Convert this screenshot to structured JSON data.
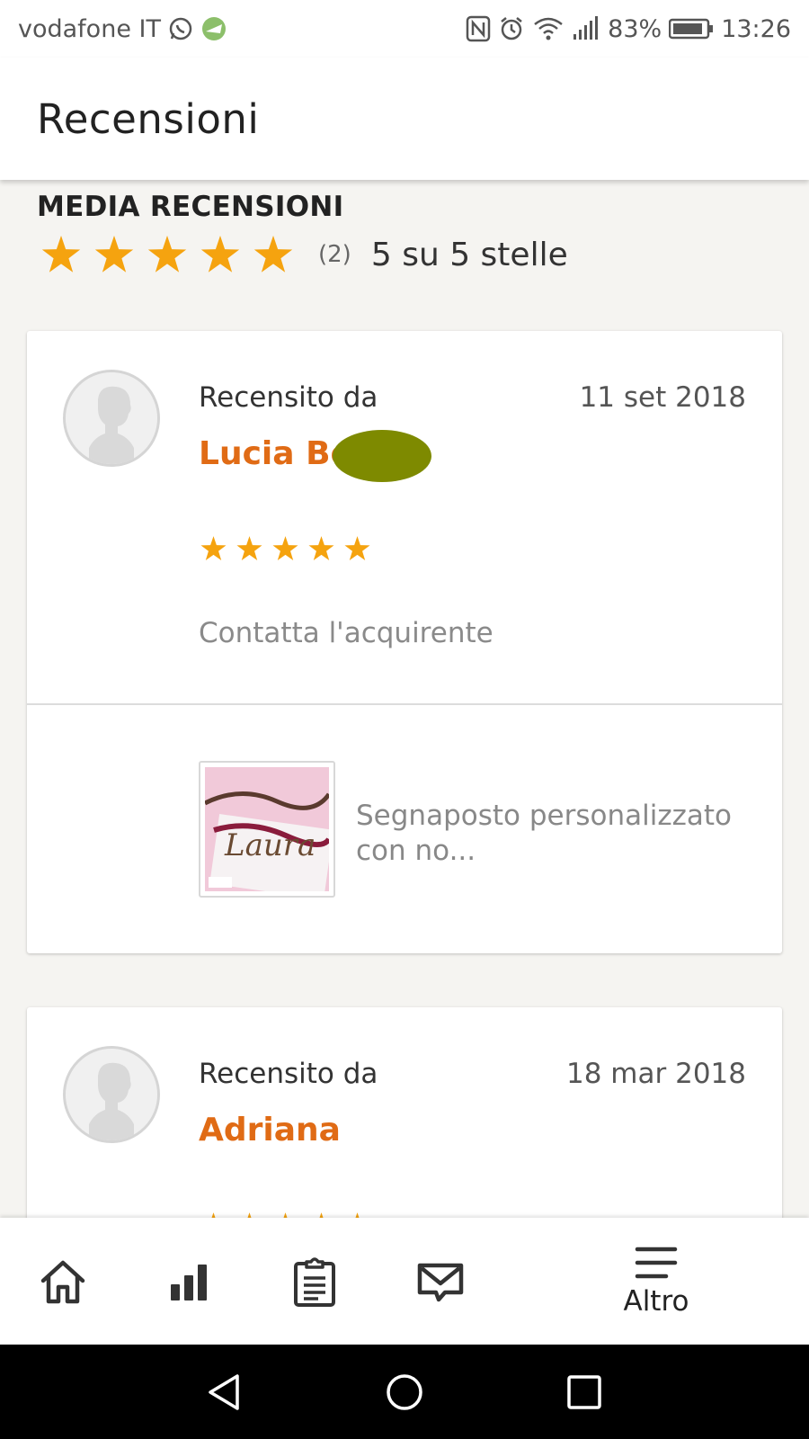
{
  "status_bar": {
    "carrier": "vodafone IT",
    "battery_percent": "83%",
    "time": "13:26"
  },
  "app_bar": {
    "title": "Recensioni"
  },
  "average": {
    "heading": "MEDIA RECENSIONI",
    "rating": 5,
    "count": "(2)",
    "summary": "5 su 5 stelle"
  },
  "reviews": [
    {
      "reviewed_by_label": "Recensito da",
      "date": "11 set 2018",
      "reviewer": "Lucia Be",
      "rating": 5,
      "contact_label": "Contatta l'acquirente",
      "product_title": "Segnaposto personalizzato  con no...",
      "product_image_text": "Laura"
    },
    {
      "reviewed_by_label": "Recensito da",
      "date": "18 mar 2018",
      "reviewer": "Adriana",
      "rating": 5
    }
  ],
  "bottom_nav": {
    "items": [
      {
        "icon": "home-icon"
      },
      {
        "icon": "stats-icon"
      },
      {
        "icon": "orders-icon"
      },
      {
        "icon": "messages-icon"
      },
      {
        "icon": "menu-icon",
        "label": "Altro"
      }
    ]
  },
  "colors": {
    "accent": "#e06b15",
    "star": "#f5a30f",
    "background": "#f5f4f1"
  }
}
